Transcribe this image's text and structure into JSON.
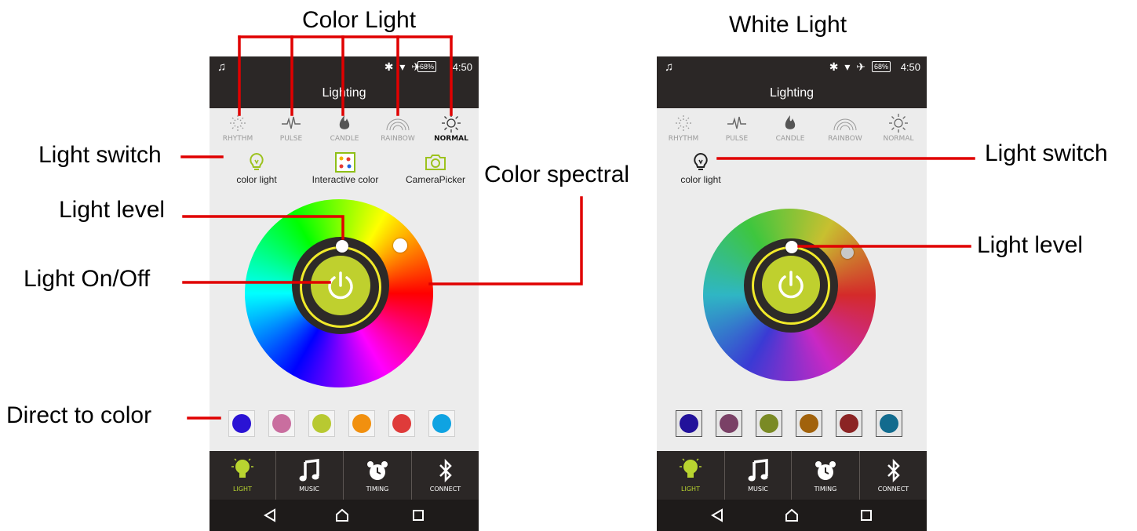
{
  "callouts": {
    "color_light_header": "Color Light",
    "white_light_header": "White Light",
    "left_light_switch": "Light switch",
    "left_light_level": "Light level",
    "left_light_onoff": "Light On/Off",
    "left_direct_color": "Direct to color",
    "color_spectral": "Color spectral",
    "right_light_switch": "Light switch",
    "right_light_level": "Light level"
  },
  "phone_color": {
    "status": {
      "battery": "68%",
      "time": "4:50"
    },
    "title": "Lighting",
    "modes": [
      {
        "label": "RHYTHM",
        "icon": "rhythm-icon"
      },
      {
        "label": "PULSE",
        "icon": "pulse-icon"
      },
      {
        "label": "CANDLE",
        "icon": "candle-icon"
      },
      {
        "label": "RAINBOW",
        "icon": "rainbow-icon"
      },
      {
        "label": "NORMAL",
        "icon": "sun-icon"
      }
    ],
    "tools": [
      {
        "label": "color light",
        "icon": "bulb-icon"
      },
      {
        "label": "Interactive color",
        "icon": "palette-icon"
      },
      {
        "label": "CameraPicker",
        "icon": "camera-icon"
      }
    ],
    "swatches": [
      "#2a13d4",
      "#c96e9f",
      "#b8c931",
      "#f1900f",
      "#df3b3a",
      "#0fa3e2"
    ],
    "nav": [
      {
        "label": "LIGHT",
        "icon": "bulb-icon"
      },
      {
        "label": "MUSIC",
        "icon": "music-note-icon"
      },
      {
        "label": "TIMING",
        "icon": "alarm-clock-icon"
      },
      {
        "label": "CONNECT",
        "icon": "bluetooth-icon"
      }
    ]
  },
  "phone_white": {
    "status": {
      "battery": "68%",
      "time": "4:50"
    },
    "title": "Lighting",
    "modes": [
      {
        "label": "RHYTHM",
        "icon": "rhythm-icon"
      },
      {
        "label": "PULSE",
        "icon": "pulse-icon"
      },
      {
        "label": "CANDLE",
        "icon": "candle-icon"
      },
      {
        "label": "RAINBOW",
        "icon": "rainbow-icon"
      },
      {
        "label": "NORMAL",
        "icon": "sun-icon"
      }
    ],
    "tools": [
      {
        "label": "color light",
        "icon": "bulb-icon"
      }
    ],
    "swatches": [
      "#22119a",
      "#7a4166",
      "#7a8a25",
      "#a1620c",
      "#8b2424",
      "#126b8e"
    ],
    "nav": [
      {
        "label": "LIGHT",
        "icon": "bulb-icon"
      },
      {
        "label": "MUSIC",
        "icon": "music-note-icon"
      },
      {
        "label": "TIMING",
        "icon": "alarm-clock-icon"
      },
      {
        "label": "CONNECT",
        "icon": "bluetooth-icon"
      }
    ]
  },
  "colors": {
    "accent_green": "#bfd02e",
    "ring_yellow": "#f1ea2a",
    "annotation_red": "#e00000",
    "bar_dark": "#2b2726"
  }
}
